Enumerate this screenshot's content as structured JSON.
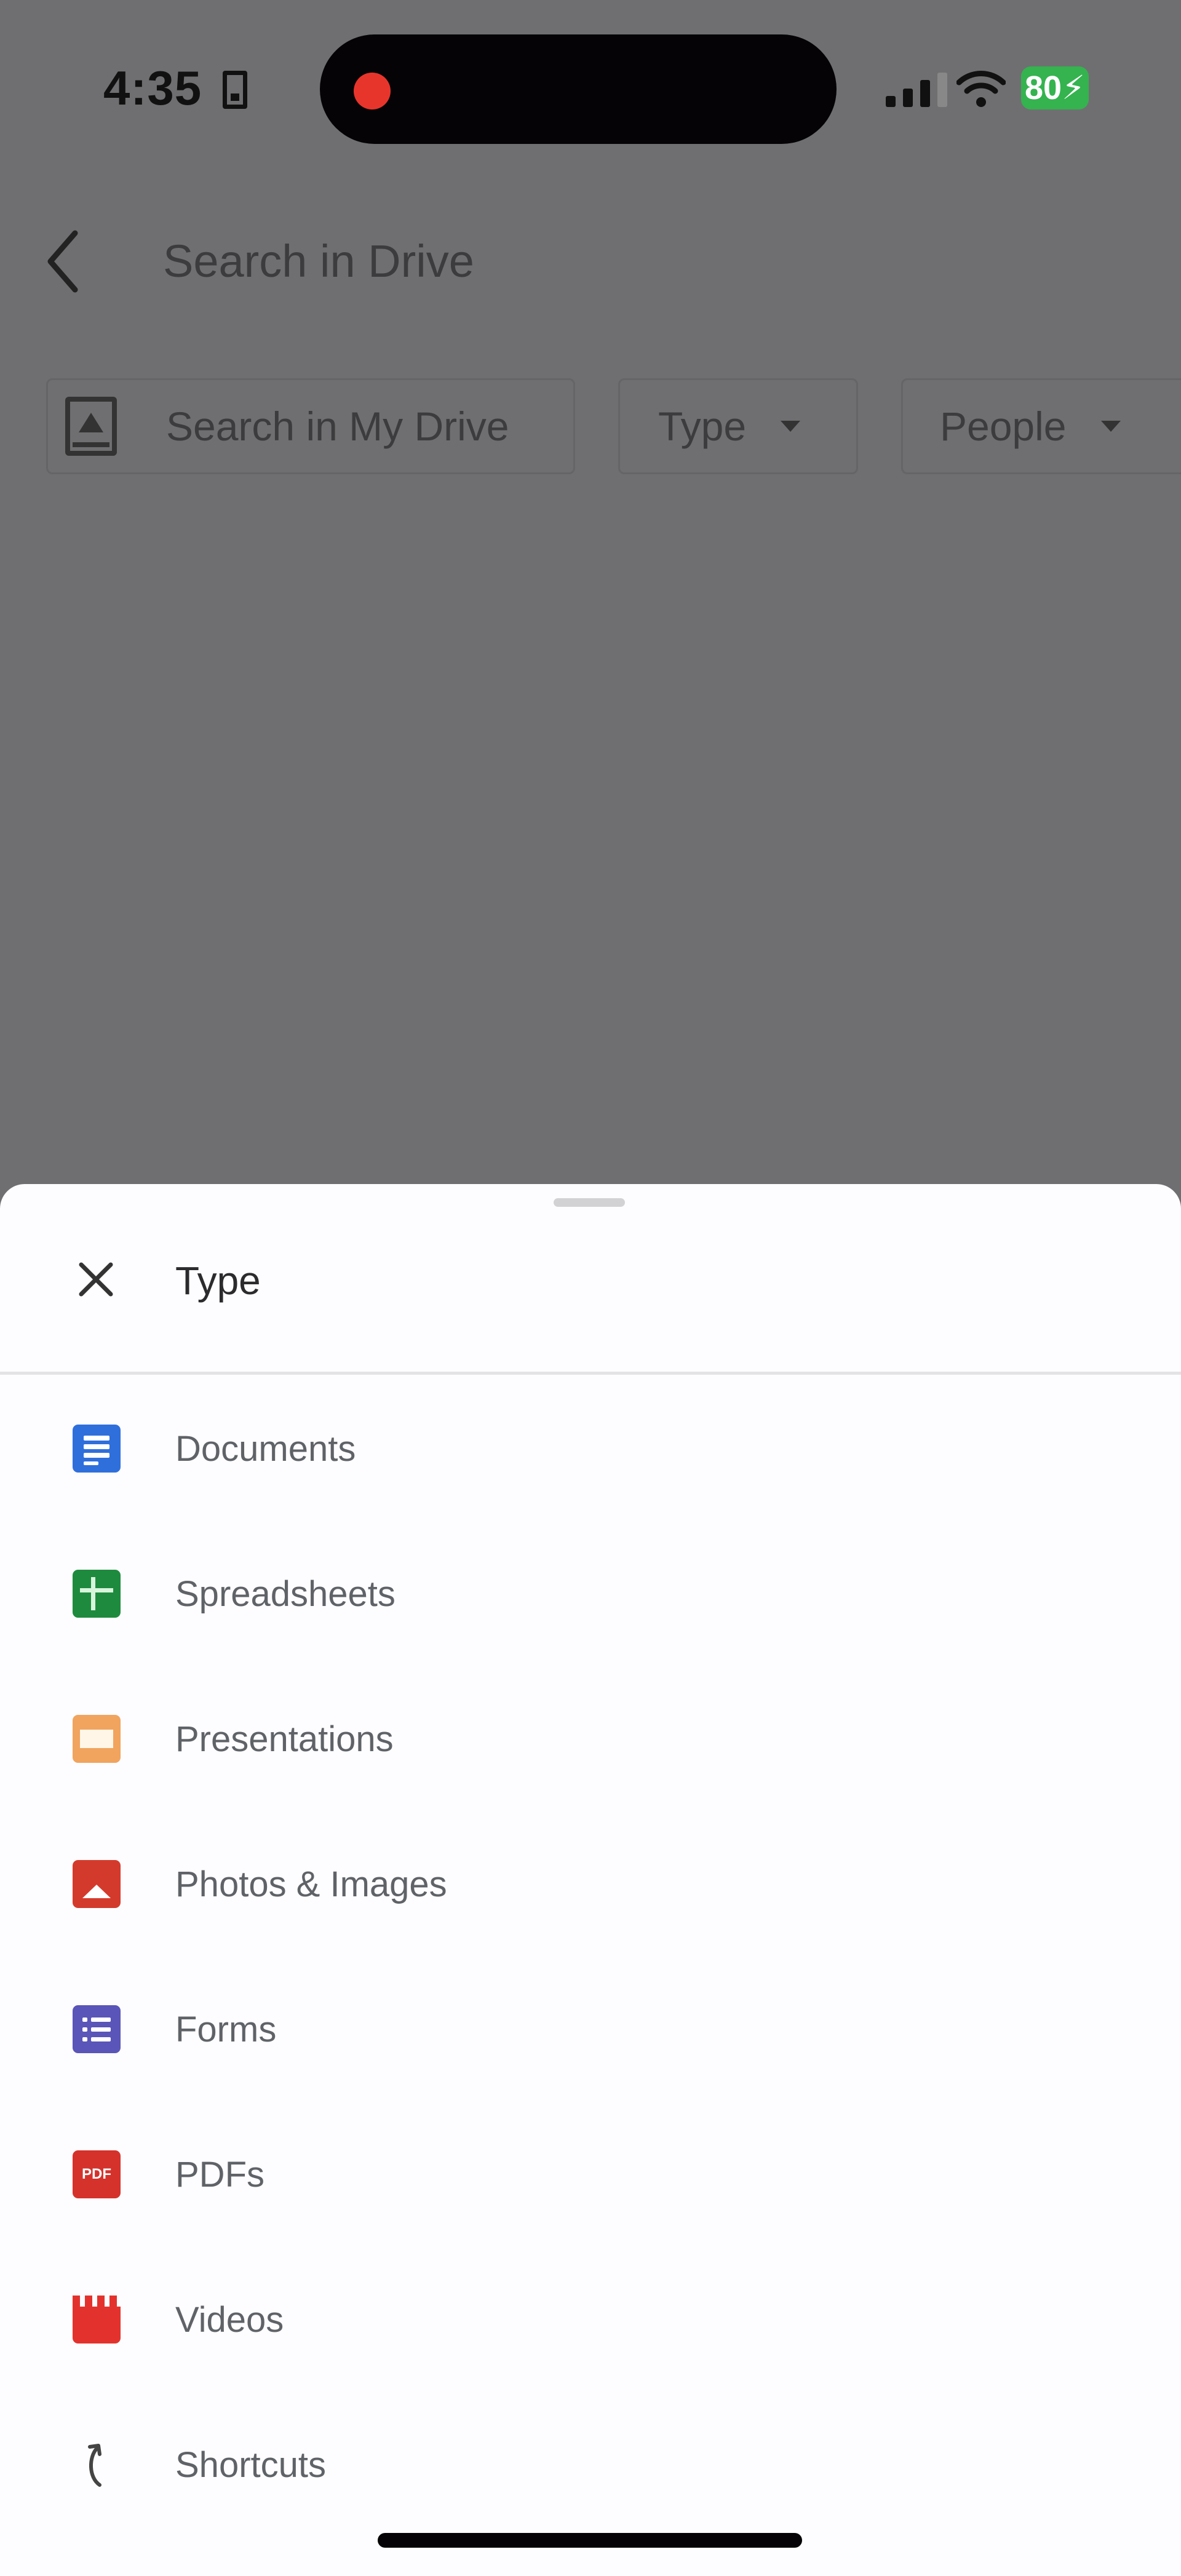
{
  "status_bar": {
    "time": "4:35",
    "battery": "80",
    "recording_dot_color": "#e8352c",
    "battery_color": "#34b34f"
  },
  "header": {
    "search_placeholder": "Search in Drive"
  },
  "chips": [
    {
      "label": "Search in My Drive",
      "icon": "drive-icon"
    },
    {
      "label": "Type",
      "icon": "chevron-down-icon"
    },
    {
      "label": "People",
      "icon": "chevron-down-icon"
    }
  ],
  "sheet": {
    "title": "Type",
    "items": [
      {
        "label": "Documents",
        "icon": "docs-icon",
        "color": "#2f6fdc"
      },
      {
        "label": "Spreadsheets",
        "icon": "sheets-icon",
        "color": "#1e8a3e"
      },
      {
        "label": "Presentations",
        "icon": "slides-icon",
        "color": "#f0a45e"
      },
      {
        "label": "Photos & Images",
        "icon": "photos-icon",
        "color": "#d43a2c"
      },
      {
        "label": "Forms",
        "icon": "forms-icon",
        "color": "#5a55b8"
      },
      {
        "label": "PDFs",
        "icon": "pdf-icon",
        "color": "#d5322c",
        "glyph": "PDF"
      },
      {
        "label": "Videos",
        "icon": "video-icon",
        "color": "#e3322d"
      },
      {
        "label": "Shortcuts",
        "icon": "shortcut-icon",
        "color": "#444444"
      }
    ]
  }
}
